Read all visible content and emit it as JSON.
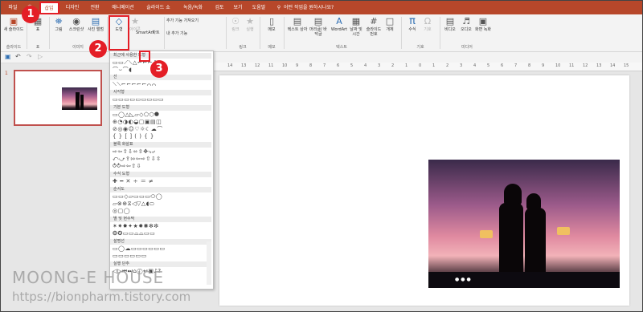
{
  "tabs": [
    "파일",
    "홈",
    "삽입",
    "디자인",
    "전환",
    "애니메이션",
    "슬라이드 쇼",
    "녹음/녹화",
    "검토",
    "보기",
    "도움말"
  ],
  "active_tab": "삽입",
  "search_placeholder": "어떤 작업을 원하시나요?",
  "ribbon": {
    "new_slide": "새 슬라이드",
    "slides_group": "슬라이드",
    "table": "표",
    "table_group": "표",
    "picture": "그림",
    "screenshot": "스크린샷",
    "photo_album": "사진 앨범",
    "images_group": "이미지",
    "shapes": "도형",
    "icons": "아이콘",
    "3d_models": "3D 모델",
    "smartart": "SmartArt",
    "chart": "차트",
    "get_addins": "추가 기능 가져오기",
    "my_addins": "내 추가 기능",
    "link": "링크",
    "action": "실행",
    "links_group": "링크",
    "comment": "메모",
    "comments_group": "메모",
    "textbox": "텍스트 상자",
    "header_footer": "머리글/ 바닥글",
    "wordart": "WordArt",
    "datetime": "날짜 및 시간",
    "slide_number": "슬라이드 번호",
    "object": "개체",
    "text_group": "텍스트",
    "equation": "수식",
    "symbol": "기호",
    "symbols_group": "기호",
    "video": "비디오",
    "audio": "오디오",
    "screen_recording": "화면 녹화",
    "media_group": "미디어"
  },
  "shapes_menu": {
    "header": "최근에 사용한 도형",
    "sections": [
      "선",
      "사각형",
      "기본 도형",
      "블록 화살표",
      "수식 도형",
      "순서도",
      "별 및 현수막",
      "설명선",
      "실행 단추"
    ]
  },
  "slide_panel": {
    "number": "1"
  },
  "ruler_ticks": [
    "14",
    "13",
    "12",
    "11",
    "10",
    "9",
    "8",
    "7",
    "6",
    "5",
    "4",
    "3",
    "2",
    "1",
    "0",
    "1",
    "2",
    "3",
    "4",
    "5",
    "6",
    "7",
    "8",
    "9",
    "10",
    "11",
    "12",
    "13",
    "14",
    "15"
  ],
  "markers": [
    "1",
    "2",
    "3"
  ],
  "watermark": {
    "line1": "MOONG-E HOUSE",
    "line2": "https://bionpharm.tistory.com"
  },
  "colors": {
    "accent": "#b7472a",
    "highlight": "#e41e26"
  }
}
